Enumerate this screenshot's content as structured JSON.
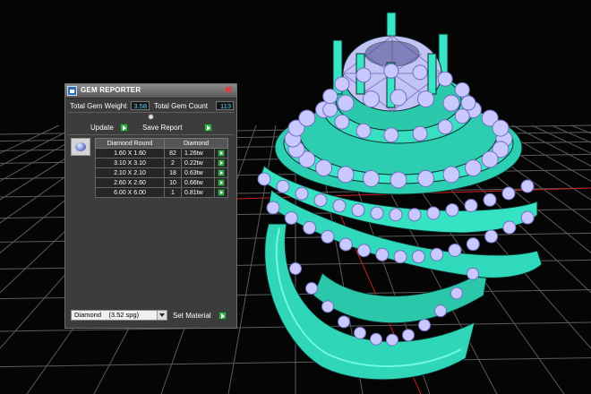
{
  "panel": {
    "title": "GEM REPORTER",
    "total_weight_label": "Total Gem Weight",
    "total_weight_value": "3.58",
    "total_count_label": "Total Gem Count",
    "total_count_value": "113",
    "update_label": "Update",
    "save_report_label": "Save Report",
    "table": {
      "headers": [
        "Diamond Round",
        "Diamond"
      ],
      "rows": [
        {
          "size": "1.60 X 1.60",
          "count": "82",
          "tw": "1.26tw"
        },
        {
          "size": "3.10 X 3.10",
          "count": "2",
          "tw": "0.22tw"
        },
        {
          "size": "2.10 X 2.10",
          "count": "18",
          "tw": "0.63tw"
        },
        {
          "size": "2.60 X 2.60",
          "count": "10",
          "tw": "0.66tw"
        },
        {
          "size": "6.00 X 6.00",
          "count": "1",
          "tw": "0.81tw"
        }
      ]
    },
    "material_select": "Diamond    (3.52 spg)",
    "set_material_label": "Set Material"
  },
  "icons": {
    "close": "close-icon",
    "go": "play-arrow-icon",
    "gem": "round-gem-icon",
    "app": "app-window-icon"
  },
  "colors": {
    "ring_wire": "#3ef0d0",
    "gem_fill": "#c9c8ff",
    "grid": "#6a6a6a",
    "button_green": "#3aa84c",
    "value_text": "#4fd8ff"
  }
}
